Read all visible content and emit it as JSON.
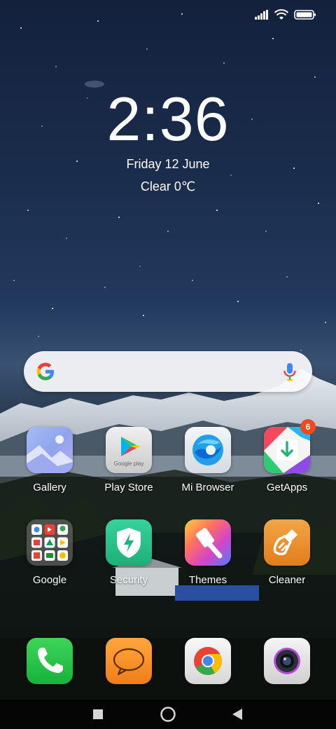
{
  "clock": {
    "time": "2:36",
    "date": "Friday 12 June",
    "weather": "Clear  0℃"
  },
  "status": {
    "icons": [
      "signal-icon",
      "wifi-icon",
      "battery-icon"
    ]
  },
  "search": {
    "icons": [
      "google-g-icon",
      "microphone-icon"
    ]
  },
  "apps": [
    {
      "label": "Gallery",
      "icon": "gallery-icon"
    },
    {
      "label": "Play Store",
      "icon": "play-store-icon",
      "caption": "Google play"
    },
    {
      "label": "Mi Browser",
      "icon": "mi-browser-icon"
    },
    {
      "label": "GetApps",
      "icon": "getapps-icon",
      "badge": "6"
    },
    {
      "label": "Google",
      "icon": "google-folder-icon"
    },
    {
      "label": "Security",
      "icon": "security-icon"
    },
    {
      "label": "Themes",
      "icon": "themes-icon"
    },
    {
      "label": "Cleaner",
      "icon": "cleaner-icon"
    }
  ],
  "dock": [
    {
      "icon": "phone-icon"
    },
    {
      "icon": "messaging-icon"
    },
    {
      "icon": "chrome-icon"
    },
    {
      "icon": "camera-icon"
    }
  ],
  "nav": {
    "icons": [
      "recents-square-icon",
      "home-circle-icon",
      "back-triangle-icon"
    ]
  },
  "colors": {
    "badge": "#f24a1d",
    "sky": "#1b2d4d",
    "search_bar": "#fafafc"
  }
}
